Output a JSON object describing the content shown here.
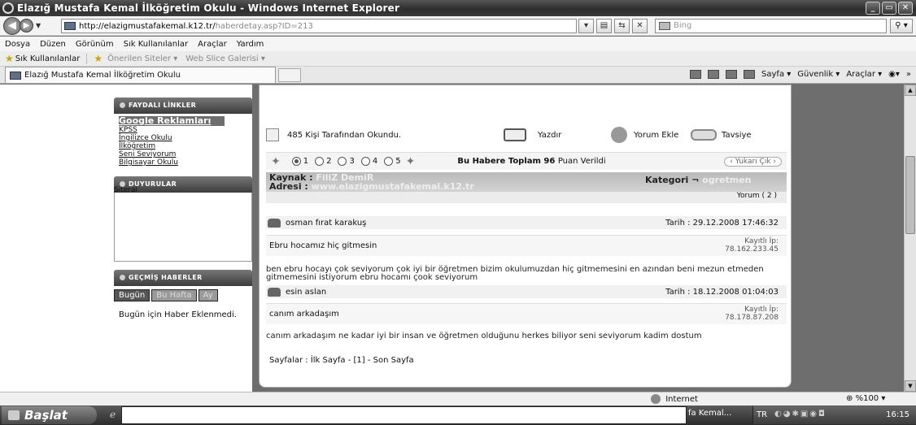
{
  "window": {
    "title": "Elazığ Mustafa Kemal İlköğretim Okulu - Windows Internet Explorer",
    "controls": {
      "minimize": "_",
      "maximize": "▭",
      "close": "✕"
    }
  },
  "address": {
    "url_host": "http://elazigmustafakemal.k12.tr/",
    "url_path": "haberdetay.asp?ID=213",
    "search_placeholder": "Bing"
  },
  "menu": [
    "Dosya",
    "Düzen",
    "Görünüm",
    "Sık Kullanılanlar",
    "Araçlar",
    "Yardım"
  ],
  "favorites": {
    "label": "Sık Kullanılanlar",
    "suggested": "Önerilen Siteler ▾",
    "webslice": "Web Slice Galerisi ▾"
  },
  "tab": {
    "title": "Elazığ Mustafa Kemal İlköğretim Okulu"
  },
  "commandbar": {
    "page": "Sayfa ▾",
    "safety": "Güvenlik ▾",
    "tools": "Araçlar ▾",
    "more": "»"
  },
  "sidebar": {
    "links": {
      "title": "FAYDALI LİNKLER",
      "items": [
        "Google Reklamları",
        "KPSS",
        "İngilizce Okulu",
        "İlköğretim",
        "Seni Seviyorum",
        "Bilgisayar Okulu"
      ]
    },
    "announcements": {
      "title": "DUYURULAR",
      "text": "Siteral"
    },
    "past_news": {
      "title": "GEÇMİŞ HABERLER",
      "tabs": [
        "Bugün",
        "Bu Hafta",
        "Ay"
      ],
      "message": "Bugün için Haber Eklenmedi."
    }
  },
  "article": {
    "read_count": "485 Kişi Tarafından Okundu.",
    "print": "Yazdır",
    "add_comment": "Yorum Ekle",
    "recommend": "Tavsiye",
    "rating_options": [
      "1",
      "2",
      "3",
      "4",
      "5"
    ],
    "rating_selected": "1",
    "rating_prefix": "Bu Habere Toplam",
    "rating_total": "96",
    "rating_suffix": "Puan Verildi",
    "back_to_top": "‹ Yukarı Çık ›",
    "source_label": "Kaynak :",
    "source_value": "FiliZ DemiR",
    "address_label": "Adresi  :",
    "address_value": "www.elazigmustafakemal.k12.tr",
    "category_label": "Kategori ¬",
    "category_value": "ogretmen",
    "comment_count": "Yorum ( 2 )",
    "comments": [
      {
        "author": "osman fırat karakuş",
        "date": "Tarih : 29.12.2008 17:46:32",
        "title": "Ebru hocamız hiç gitmesin",
        "ip_label": "Kayıtlı İp:",
        "ip": "78.162.233.45",
        "body": "ben ebru hocayı çok seviyorum çok iyi bir öğretmen bizim okulumuzdan hiç gitmemesini en azından beni mezun etmeden gitmemesini istiyorum ebru hocamı çook seviyorum"
      },
      {
        "author": "esin aslan",
        "date": "Tarih : 18.12.2008 01:04:03",
        "title": "canım arkadaşım",
        "ip_label": "Kayıtlı İp:",
        "ip": "78.178.87.208",
        "body": "canım arkadaşım ne kadar iyi bir insan ve öğretmen olduğunu herkes biliyor seni seviyorum kadim dostum"
      }
    ],
    "pages": "Sayfalar : İlk Sayfa - [1] - Son Sayfa"
  },
  "status": {
    "zone": "Internet",
    "zoom": "%100"
  },
  "taskbar": {
    "start": "Başlat",
    "item": "fa Kemal...",
    "lang": "TR",
    "clock": "16:15"
  }
}
